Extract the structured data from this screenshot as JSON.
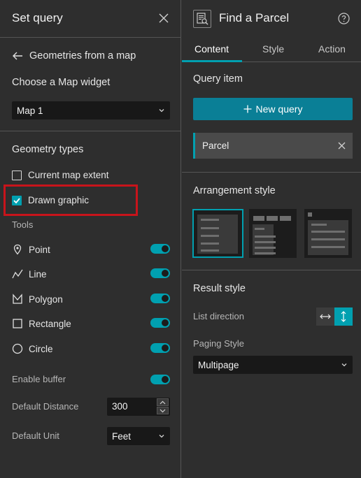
{
  "left_panel": {
    "title": "Set query",
    "back_label": "Geometries from a map",
    "choose_map_label": "Choose a Map widget",
    "map_select_value": "Map 1",
    "geometry_types_title": "Geometry types",
    "geometry_types": [
      {
        "label": "Current map extent",
        "checked": false
      },
      {
        "label": "Drawn graphic",
        "checked": true
      }
    ],
    "tools_title": "Tools",
    "tools": [
      {
        "label": "Point",
        "icon": "point-icon",
        "enabled": true
      },
      {
        "label": "Line",
        "icon": "polyline-icon",
        "enabled": true
      },
      {
        "label": "Polygon",
        "icon": "polygon-icon",
        "enabled": true
      },
      {
        "label": "Rectangle",
        "icon": "rectangle-icon",
        "enabled": true
      },
      {
        "label": "Circle",
        "icon": "circle-icon",
        "enabled": true
      }
    ],
    "enable_buffer_label": "Enable buffer",
    "enable_buffer": true,
    "default_distance_label": "Default Distance",
    "default_distance_value": "300",
    "default_unit_label": "Default Unit",
    "default_unit_value": "Feet"
  },
  "right_panel": {
    "title": "Find a Parcel",
    "tabs": [
      {
        "label": "Content",
        "active": true
      },
      {
        "label": "Style",
        "active": false
      },
      {
        "label": "Action",
        "active": false
      }
    ],
    "query_item_title": "Query item",
    "new_query_label": "New query",
    "query_items": [
      "Parcel"
    ],
    "arrangement_title": "Arrangement style",
    "result_style_title": "Result style",
    "list_direction_label": "List direction",
    "list_direction": "vertical",
    "paging_style_label": "Paging Style",
    "paging_style_value": "Multipage"
  },
  "colors": {
    "accent": "#00a0b0",
    "highlight_box": "#c8141b",
    "background": "#2e2e2e",
    "input_bg": "#181818"
  }
}
